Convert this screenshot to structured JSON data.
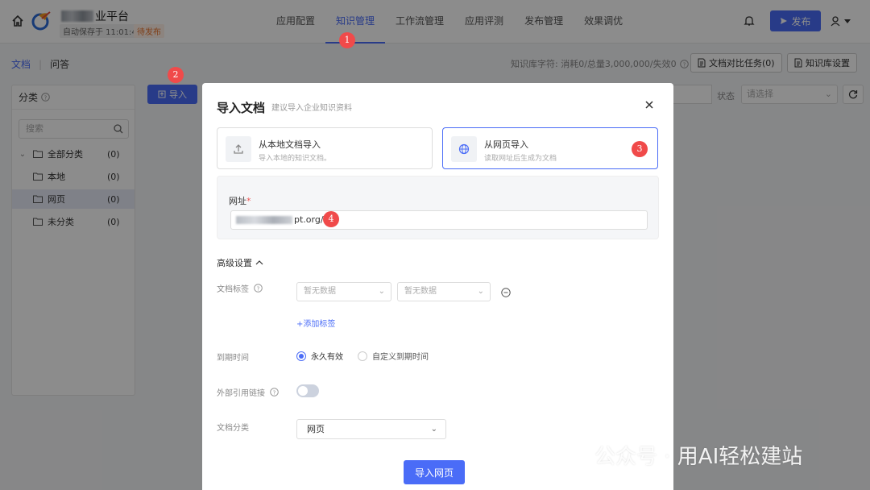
{
  "header": {
    "app_title_suffix": "业平台",
    "autosave": "自动保存于 11:01:45",
    "draft_badge": "待发布",
    "nav": [
      "应用配置",
      "知识管理",
      "工作流管理",
      "应用评测",
      "发布管理",
      "效果调优"
    ],
    "active_nav_index": 1,
    "publish_label": "发布"
  },
  "subheader": {
    "tab_docs": "文档",
    "tab_qa": "问答",
    "quota": "知识库字符: 消耗0/总量3,000,000/失效0",
    "compare_tasks_label": "文档对比任务(0)",
    "kb_settings_label": "知识库设置"
  },
  "left_panel": {
    "title": "分类",
    "search_placeholder": "搜索",
    "tree": [
      {
        "name": "全部分类",
        "count": "(0)"
      },
      {
        "name": "本地",
        "count": "(0)"
      },
      {
        "name": "网页",
        "count": "(0)"
      },
      {
        "name": "未分类",
        "count": "(0)"
      }
    ]
  },
  "toolbar": {
    "import_label": "导入",
    "status_label": "状态",
    "status_placeholder": "请选择"
  },
  "modal": {
    "title": "导入文档",
    "subtitle": "建议导入企业知识资料",
    "source_local_title": "从本地文档导入",
    "source_local_desc": "导入本地的知识文档。",
    "source_web_title": "从网页导入",
    "source_web_desc": "读取网址后生成为文档",
    "url_label": "网址",
    "url_value_suffix": "pt.org/",
    "advanced_label": "高级设置",
    "doc_tags_label": "文档标签",
    "tag_placeholder_1": "暂无数据",
    "tag_placeholder_2": "暂无数据",
    "add_tag_label": "+添加标签",
    "expiry_label": "到期时间",
    "expiry_permanent": "永久有效",
    "expiry_custom": "自定义到期时间",
    "external_link_label": "外部引用链接",
    "external_link_enabled": false,
    "category_label": "文档分类",
    "category_value": "网页",
    "submit_label": "导入网页"
  },
  "markers": [
    "1",
    "2",
    "3",
    "4"
  ],
  "watermark": "公众号 · 用AI轻松建站",
  "colors": {
    "primary": "#4a6cf7",
    "marker": "#f04a4a",
    "draft": "#e8742e"
  }
}
